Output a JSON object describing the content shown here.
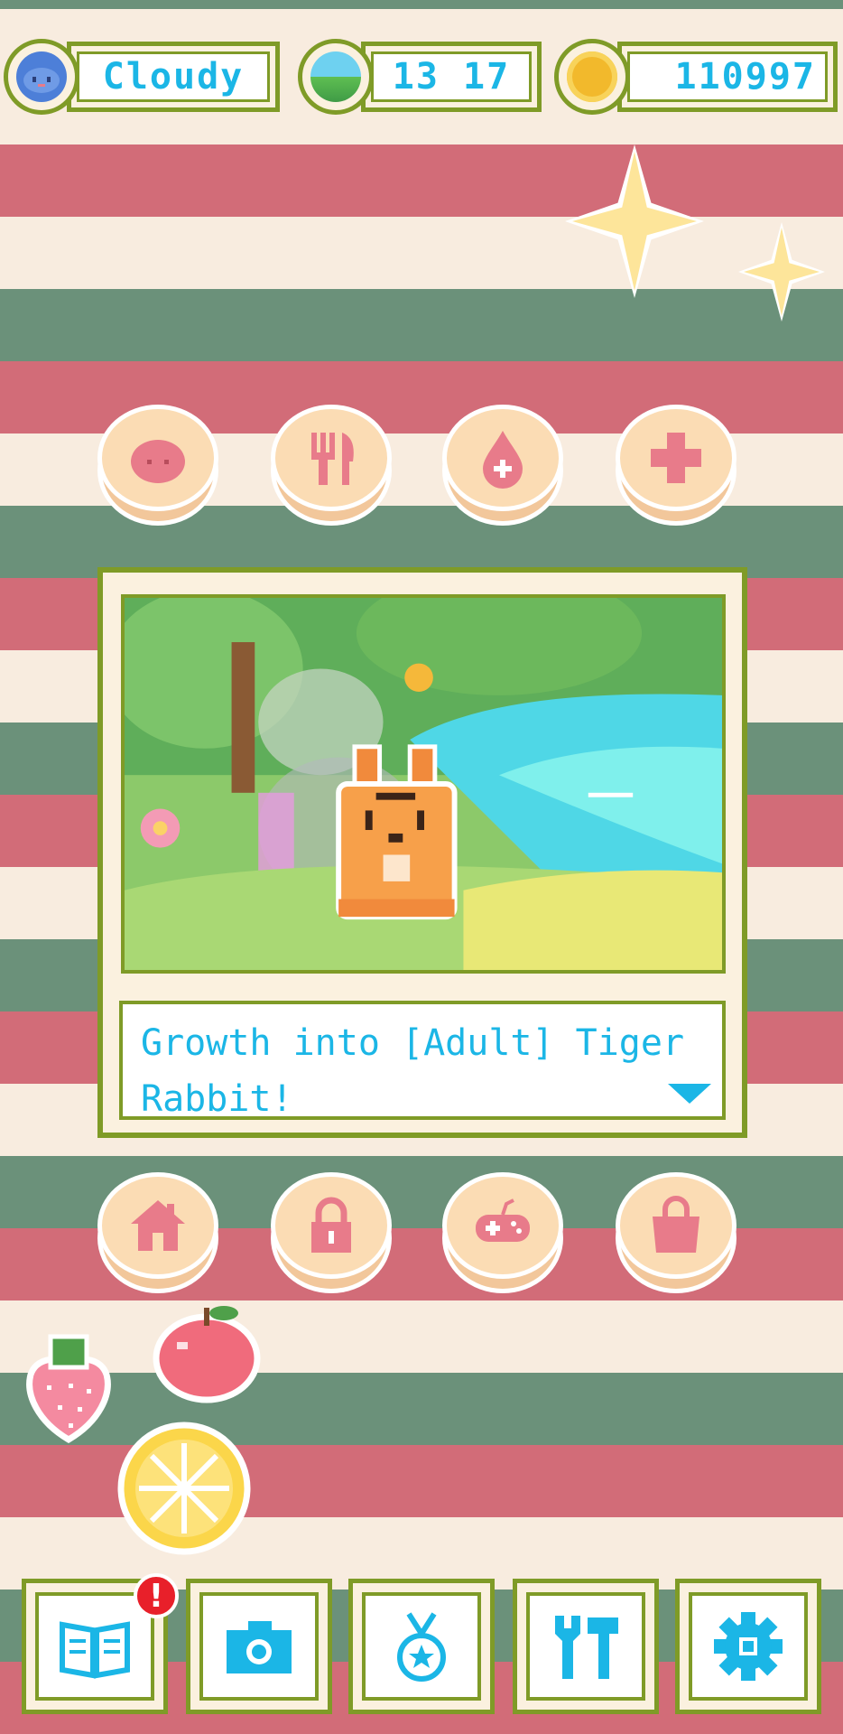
{
  "hud": {
    "weather": {
      "icon": "cloud-face-icon",
      "label": "Cloudy"
    },
    "time": {
      "icon": "landscape-icon",
      "label": "13 17"
    },
    "coins": {
      "icon": "coin-icon",
      "label": "110997"
    }
  },
  "actions_top": [
    {
      "name": "pet-button",
      "icon": "blob-face-icon"
    },
    {
      "name": "feed-button",
      "icon": "fork-knife-icon"
    },
    {
      "name": "clean-button",
      "icon": "water-drop-plus-icon"
    },
    {
      "name": "heal-button",
      "icon": "medical-cross-icon"
    }
  ],
  "message": {
    "text": "Growth into [Adult] Tiger Rabbit!"
  },
  "actions_bottom": [
    {
      "name": "home-button",
      "icon": "house-icon"
    },
    {
      "name": "lock-button",
      "icon": "padlock-icon"
    },
    {
      "name": "play-button",
      "icon": "gamepad-icon"
    },
    {
      "name": "shop-button",
      "icon": "shopping-bag-icon"
    }
  ],
  "fruits": [
    "strawberry-icon",
    "apple-icon",
    "lemon-slice-icon"
  ],
  "nav": [
    {
      "name": "encyclopedia-button",
      "icon": "book-icon",
      "alert": "!"
    },
    {
      "name": "camera-button",
      "icon": "camera-icon"
    },
    {
      "name": "medal-button",
      "icon": "medal-icon"
    },
    {
      "name": "tools-button",
      "icon": "wrench-hammer-icon"
    },
    {
      "name": "settings-button",
      "icon": "gear-icon"
    }
  ],
  "colors": {
    "accent": "#1bb6e6",
    "frame": "#7f9b27",
    "pink": "#e87b8a",
    "stripe_green": "#6b917a",
    "stripe_red": "#d26c78",
    "stripe_cream": "#f8ecdf"
  }
}
